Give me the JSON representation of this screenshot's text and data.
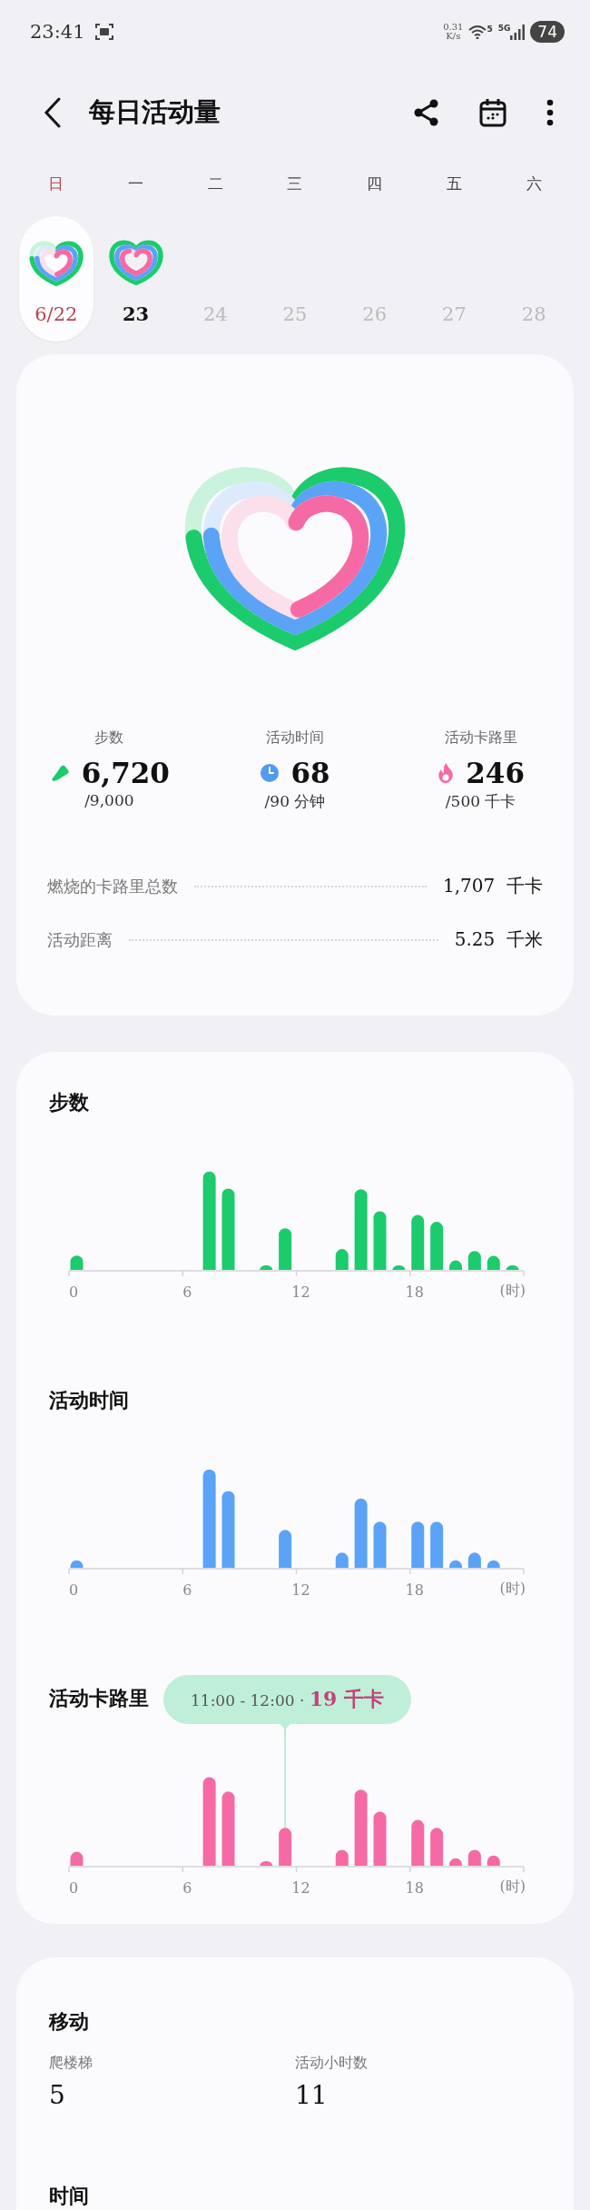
{
  "status_bar": {
    "time": "23:41",
    "net_speed": "0.31",
    "net_unit": "K/s",
    "wifi_badge": "5",
    "network": "5G",
    "battery": "74"
  },
  "header": {
    "title": "每日活动量"
  },
  "week": [
    {
      "weekday": "日",
      "date": "6/22",
      "selected": true,
      "disabled": false,
      "activity_heart": true
    },
    {
      "weekday": "一",
      "date": "23",
      "selected": false,
      "disabled": false,
      "activity_heart": true
    },
    {
      "weekday": "二",
      "date": "24",
      "selected": false,
      "disabled": true,
      "activity_heart": false
    },
    {
      "weekday": "三",
      "date": "25",
      "selected": false,
      "disabled": true,
      "activity_heart": false
    },
    {
      "weekday": "四",
      "date": "26",
      "selected": false,
      "disabled": true,
      "activity_heart": false
    },
    {
      "weekday": "五",
      "date": "27",
      "selected": false,
      "disabled": true,
      "activity_heart": false
    },
    {
      "weekday": "六",
      "date": "28",
      "selected": false,
      "disabled": true,
      "activity_heart": false
    }
  ],
  "summary": {
    "activity_heart": true,
    "stats": [
      {
        "kind": "steps",
        "label": "步数",
        "value": "6,720",
        "goal": "/9,000"
      },
      {
        "kind": "time",
        "label": "活动时间",
        "value": "68",
        "goal": "/90 分钟"
      },
      {
        "kind": "calories",
        "label": "活动卡路里",
        "value": "246",
        "goal": "/500 千卡"
      }
    ],
    "rows": [
      {
        "label": "燃烧的卡路里总数",
        "value": "1,707",
        "unit": "千卡"
      },
      {
        "label": "活动距离",
        "value": "5.25",
        "unit": "千米"
      }
    ]
  },
  "charts": [
    {
      "kind": "steps",
      "title": "步数",
      "x_labels": [
        "0",
        "6",
        "12",
        "18"
      ],
      "x_unit": "(时)"
    },
    {
      "kind": "time",
      "title": "活动时间",
      "x_labels": [
        "0",
        "6",
        "12",
        "18"
      ],
      "x_unit": "(时)"
    },
    {
      "kind": "calories",
      "title": "活动卡路里",
      "x_labels": [
        "0",
        "6",
        "12",
        "18"
      ],
      "x_unit": "(时)",
      "tooltip": {
        "range": "11:00 - 12:00",
        "separator": "·",
        "value": "19 千卡"
      }
    }
  ],
  "movement": {
    "title": "移动",
    "items": [
      {
        "label": "爬楼梯",
        "value": "5"
      },
      {
        "label": "活动小时数",
        "value": "11"
      }
    ]
  },
  "time_section": {
    "title": "时间"
  }
}
